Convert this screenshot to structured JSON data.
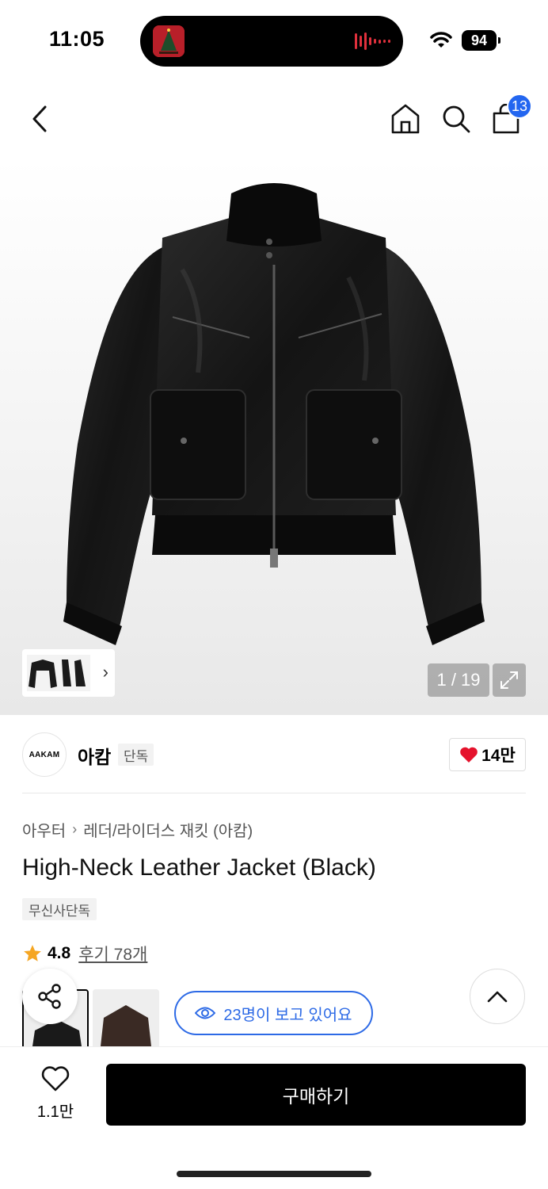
{
  "status_bar": {
    "time": "11:05",
    "battery": "94"
  },
  "nav": {
    "cart_count": "13"
  },
  "gallery": {
    "counter": "1 / 19"
  },
  "brand": {
    "logo_text": "AAKAM",
    "name": "아캄",
    "tag": "단독",
    "likes": "14만"
  },
  "breadcrumb": [
    "아우터",
    "레더/라이더스 재킷 (아캄)"
  ],
  "product": {
    "title": "High-Neck Leather Jacket (Black)",
    "exclusive_tag": "무신사단독",
    "rating": "4.8",
    "reviews": "후기 78개"
  },
  "viewers_text": "23명이 보고 있어요",
  "bottom": {
    "wish_count": "1.1만",
    "buy_label": "구매하기"
  },
  "colors": {
    "accent_blue": "#2d6ae6",
    "heart_red": "#e5122c",
    "star": "#f5a623"
  },
  "icons": [
    "back-arrow-icon",
    "home-icon",
    "search-icon",
    "cart-icon",
    "expand-icon",
    "heart-icon",
    "star-icon",
    "share-icon",
    "eye-icon",
    "chevron-up-icon",
    "wishlist-heart-icon"
  ]
}
